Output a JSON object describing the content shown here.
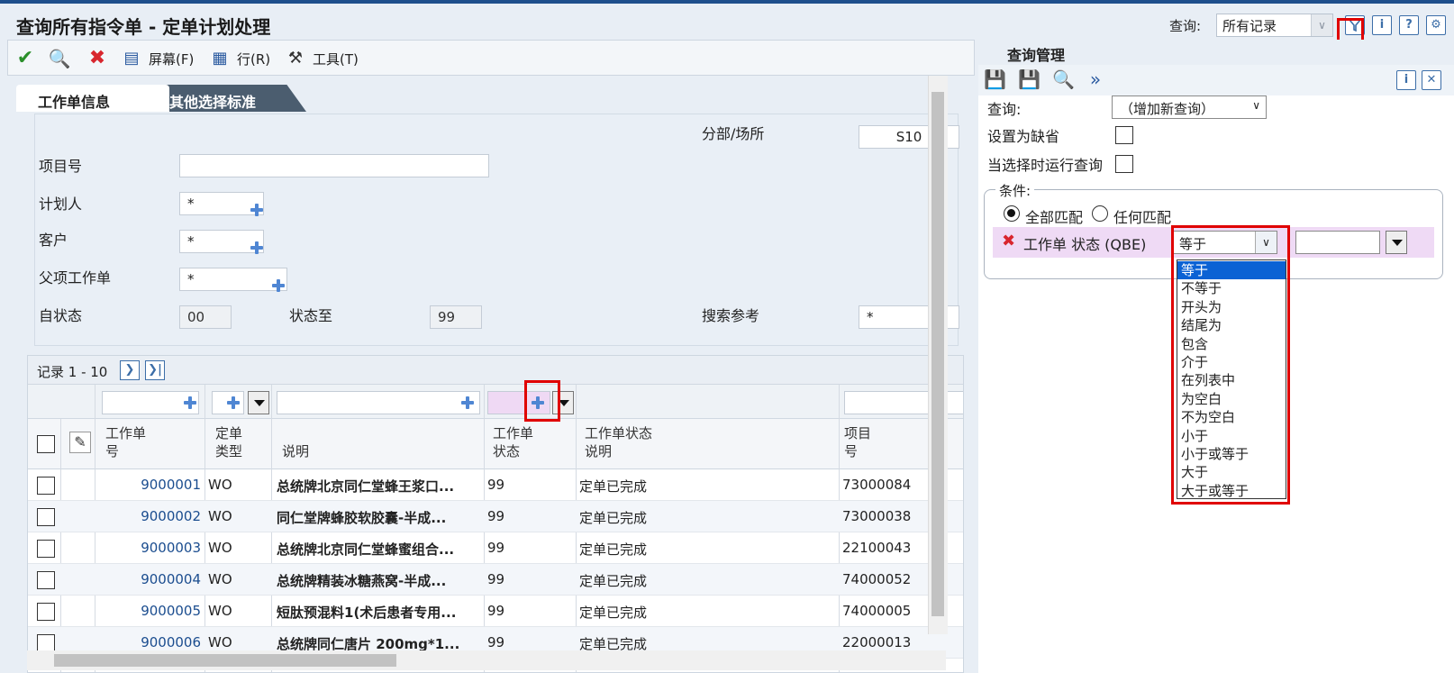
{
  "window": {
    "title": "查询所有指令单 - 定单计划处理"
  },
  "query_bar": {
    "label": "查询:",
    "selected": "所有记录"
  },
  "toolbar": {
    "screen": "屏幕(F)",
    "row": "行(R)",
    "tools": "工具(T)"
  },
  "tabs": {
    "active": "工作单信息",
    "other": "其他选择标准"
  },
  "form": {
    "branch_label": "分部/场所",
    "branch_value": "S10",
    "item_label": "项目号",
    "item_value": "",
    "planner_label": "计划人",
    "planner_value": "*",
    "customer_label": "客户",
    "customer_value": "*",
    "parent_label": "父项工作单",
    "parent_value": "*",
    "from_status_label": "自状态",
    "from_status_value": "00",
    "to_status_label": "状态至",
    "to_status_value": "99",
    "search_label": "搜索参考",
    "search_value": "*"
  },
  "grid": {
    "records": "记录 1 - 10",
    "headers": [
      "工作单\n号",
      "定单\n类型",
      "说明",
      "工作单\n状态",
      "工作单状态\n说明",
      "项目\n号"
    ],
    "rows": [
      {
        "wo": "9000001",
        "type": "WO",
        "desc": "总统牌北京同仁堂蜂王浆口...",
        "status": "99",
        "status_desc": "定单已完成",
        "item": "73000084"
      },
      {
        "wo": "9000002",
        "type": "WO",
        "desc": "同仁堂牌蜂胶软胶囊-半成...",
        "status": "99",
        "status_desc": "定单已完成",
        "item": "73000038"
      },
      {
        "wo": "9000003",
        "type": "WO",
        "desc": "总统牌北京同仁堂蜂蜜组合...",
        "status": "99",
        "status_desc": "定单已完成",
        "item": "22100043"
      },
      {
        "wo": "9000004",
        "type": "WO",
        "desc": "总统牌精装冰糖燕窝-半成...",
        "status": "99",
        "status_desc": "定单已完成",
        "item": "74000052"
      },
      {
        "wo": "9000005",
        "type": "WO",
        "desc": "短肽预混料1(术后患者专用...",
        "status": "99",
        "status_desc": "定单已完成",
        "item": "74000005"
      },
      {
        "wo": "9000006",
        "type": "WO",
        "desc": "总统牌同仁唐片 200mg*1...",
        "status": "99",
        "status_desc": "定单已完成",
        "item": "22000013"
      }
    ]
  },
  "query_mgmt": {
    "title": "查询管理",
    "query_label": "查询:",
    "query_value": "（增加新查询）",
    "set_default": "设置为缺省",
    "run_on_select": "当选择时运行查询",
    "conditions": "条件:",
    "match_all": "全部匹配",
    "match_any": "任何匹配",
    "cond_field": "工作单 状态 (QBE)",
    "operator_selected": "等于",
    "operators": [
      "等于",
      "不等于",
      "开头为",
      "结尾为",
      "包含",
      "介于",
      "在列表中",
      "为空白",
      "不为空白",
      "小于",
      "小于或等于",
      "大于",
      "大于或等于"
    ]
  },
  "colors": {
    "title_bar": "#1e4f8c",
    "selected_item": "#0b62d4",
    "highlight_box": "#e00000",
    "condition_row": "#efdaf5"
  }
}
